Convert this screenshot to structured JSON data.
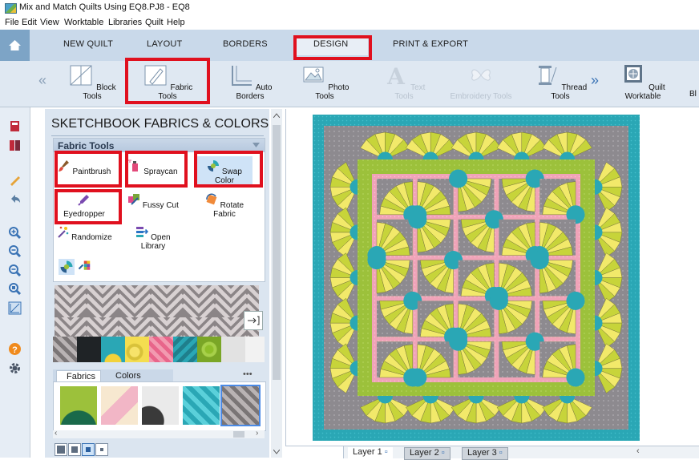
{
  "window": {
    "title": "Mix and Match Quilts Using EQ8.PJ8 - EQ8"
  },
  "menu": [
    "File",
    "Edit",
    "View",
    "Worktable",
    "Libraries",
    "Quilt",
    "Help"
  ],
  "tabs": [
    {
      "label": "NEW QUILT"
    },
    {
      "label": "LAYOUT"
    },
    {
      "label": "BORDERS"
    },
    {
      "label": "DESIGN",
      "selected": true
    },
    {
      "label": "PRINT & EXPORT"
    }
  ],
  "ribbon": {
    "tools": [
      {
        "label": "Block Tools",
        "icon": "block-tools-icon"
      },
      {
        "label": "Fabric Tools",
        "icon": "fabric-tools-icon"
      },
      {
        "label": "Auto Borders",
        "icon": "auto-borders-icon"
      },
      {
        "label": "Photo Tools",
        "icon": "photo-tools-icon"
      },
      {
        "label": "Text Tools",
        "icon": "text-tools-icon",
        "disabled": true
      },
      {
        "label": "Embroidery Tools",
        "icon": "embroidery-tools-icon",
        "disabled": true
      },
      {
        "label": "Thread Tools",
        "icon": "thread-tools-icon"
      },
      {
        "label": "Quilt Worktable",
        "icon": "quilt-worktable-icon"
      },
      {
        "label": "Bl",
        "icon": ""
      }
    ],
    "collapse_glyph": "«",
    "expand_glyph": "»"
  },
  "panel": {
    "title": "SKETCHBOOK FABRICS & COLORS",
    "section": "Fabric Tools",
    "buttons": [
      {
        "label": "Paintbrush"
      },
      {
        "label": "Spraycan"
      },
      {
        "label": "Swap Color"
      },
      {
        "label": "Eyedropper"
      },
      {
        "label": "Fussy Cut"
      },
      {
        "label": "Rotate Fabric"
      },
      {
        "label": "Randomize"
      },
      {
        "label": "Open Library"
      }
    ],
    "bottom_tabs": {
      "fabrics": "Fabrics",
      "colors": "Colors",
      "more": "•••"
    }
  },
  "layers": [
    "Layer 1",
    "Layer 2",
    "Layer 3"
  ],
  "colors": {
    "highlight_red": "#e0101e",
    "quilt_teal": "#2aa7b5",
    "quilt_gray": "#8d8a8f",
    "quilt_lime": "#9cc13b",
    "quilt_yellow": "#f2e96a",
    "quilt_pink": "#f0a3b8",
    "quilt_grey_light": "#a8a6ab"
  }
}
